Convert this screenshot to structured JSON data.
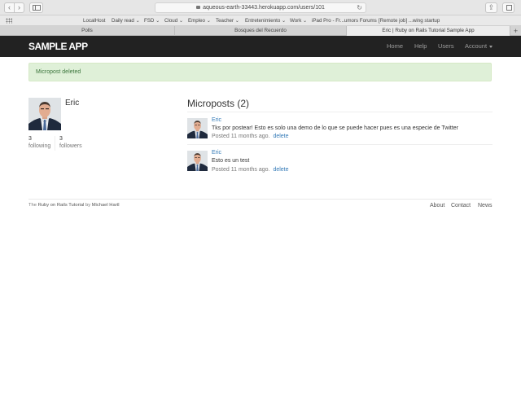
{
  "browser": {
    "url": "aqueous-earth-33443.herokuapp.com/users/101",
    "bookmarks": [
      "LocalHost",
      "Daily read ⌄",
      "FSD ⌄",
      "Cloud ⌄",
      "Empleo ⌄",
      "Teacher ⌄",
      "Entretenimiento ⌄",
      "Work ⌄",
      "iPad Pro - Fr...umors Forums",
      "[Remote job] ...wing startup"
    ],
    "tabs": [
      "Polls",
      "Bosques del Recuerdo",
      "Eric | Ruby on Rails Tutorial Sample App"
    ],
    "active_tab_index": 2
  },
  "app": {
    "brand": "SAMPLE APP",
    "nav": {
      "home": "Home",
      "help": "Help",
      "users": "Users",
      "account": "Account"
    }
  },
  "flash": {
    "message": "Micropost deleted",
    "type": "success",
    "color": "#dff0d8"
  },
  "profile": {
    "name": "Eric",
    "following_count": "3",
    "following_label": "following",
    "followers_count": "3",
    "followers_label": "followers"
  },
  "microposts": {
    "title": "Microposts (2)",
    "items": [
      {
        "user": "Eric",
        "content": "Tks por postear! Esto es solo una demo de lo que se puede hacer pues es una especie de Twitter",
        "timestamp": "Posted 11 months ago.",
        "delete_label": "delete"
      },
      {
        "user": "Eric",
        "content": "Esto es un test",
        "timestamp": "Posted 11 months ago.",
        "delete_label": "delete"
      }
    ]
  },
  "footer": {
    "prefix": "The",
    "tutorial_link": "Ruby on Rails Tutorial",
    "by": "by",
    "author_link": "Michael Hartl",
    "links": [
      "About",
      "Contact",
      "News"
    ]
  },
  "colors": {
    "navbar": "#222222",
    "link": "#337ab7",
    "flash_text": "#3c763d"
  }
}
